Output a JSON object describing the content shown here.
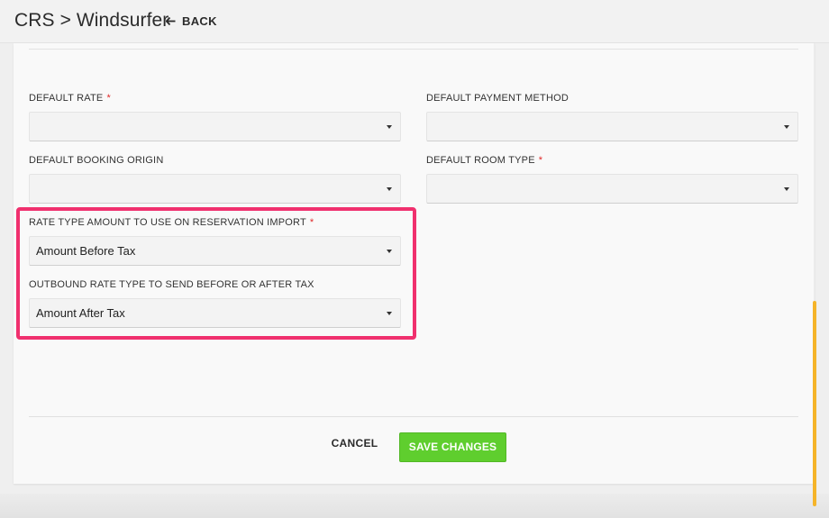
{
  "header": {
    "title": "CRS > Windsurfer",
    "back_label": "BACK"
  },
  "form": {
    "partial_text": "",
    "fields": {
      "default_rate": {
        "label": "DEFAULT RATE",
        "required": "*",
        "value": ""
      },
      "default_payment_method": {
        "label": "DEFAULT PAYMENT METHOD",
        "value": ""
      },
      "default_booking_origin": {
        "label": "DEFAULT BOOKING ORIGIN",
        "value": ""
      },
      "default_room_type": {
        "label": "DEFAULT ROOM TYPE",
        "required": "*",
        "value": ""
      },
      "rate_type_import": {
        "label": "RATE TYPE AMOUNT TO USE ON RESERVATION IMPORT",
        "required": "*",
        "value": "Amount Before Tax"
      },
      "outbound_rate_type": {
        "label": "OUTBOUND RATE TYPE TO SEND BEFORE OR AFTER TAX",
        "value": "Amount After Tax"
      }
    },
    "actions": {
      "cancel_label": "CANCEL",
      "save_label": "SAVE CHANGES"
    }
  },
  "colors": {
    "highlight_border": "#f0306e",
    "save_button": "#5fce2e",
    "required_star": "#e02a2a",
    "scrollbar_thumb": "#f5b429"
  },
  "icons": {
    "back": "arrow-left-icon",
    "select_caret": "caret-down-icon"
  }
}
